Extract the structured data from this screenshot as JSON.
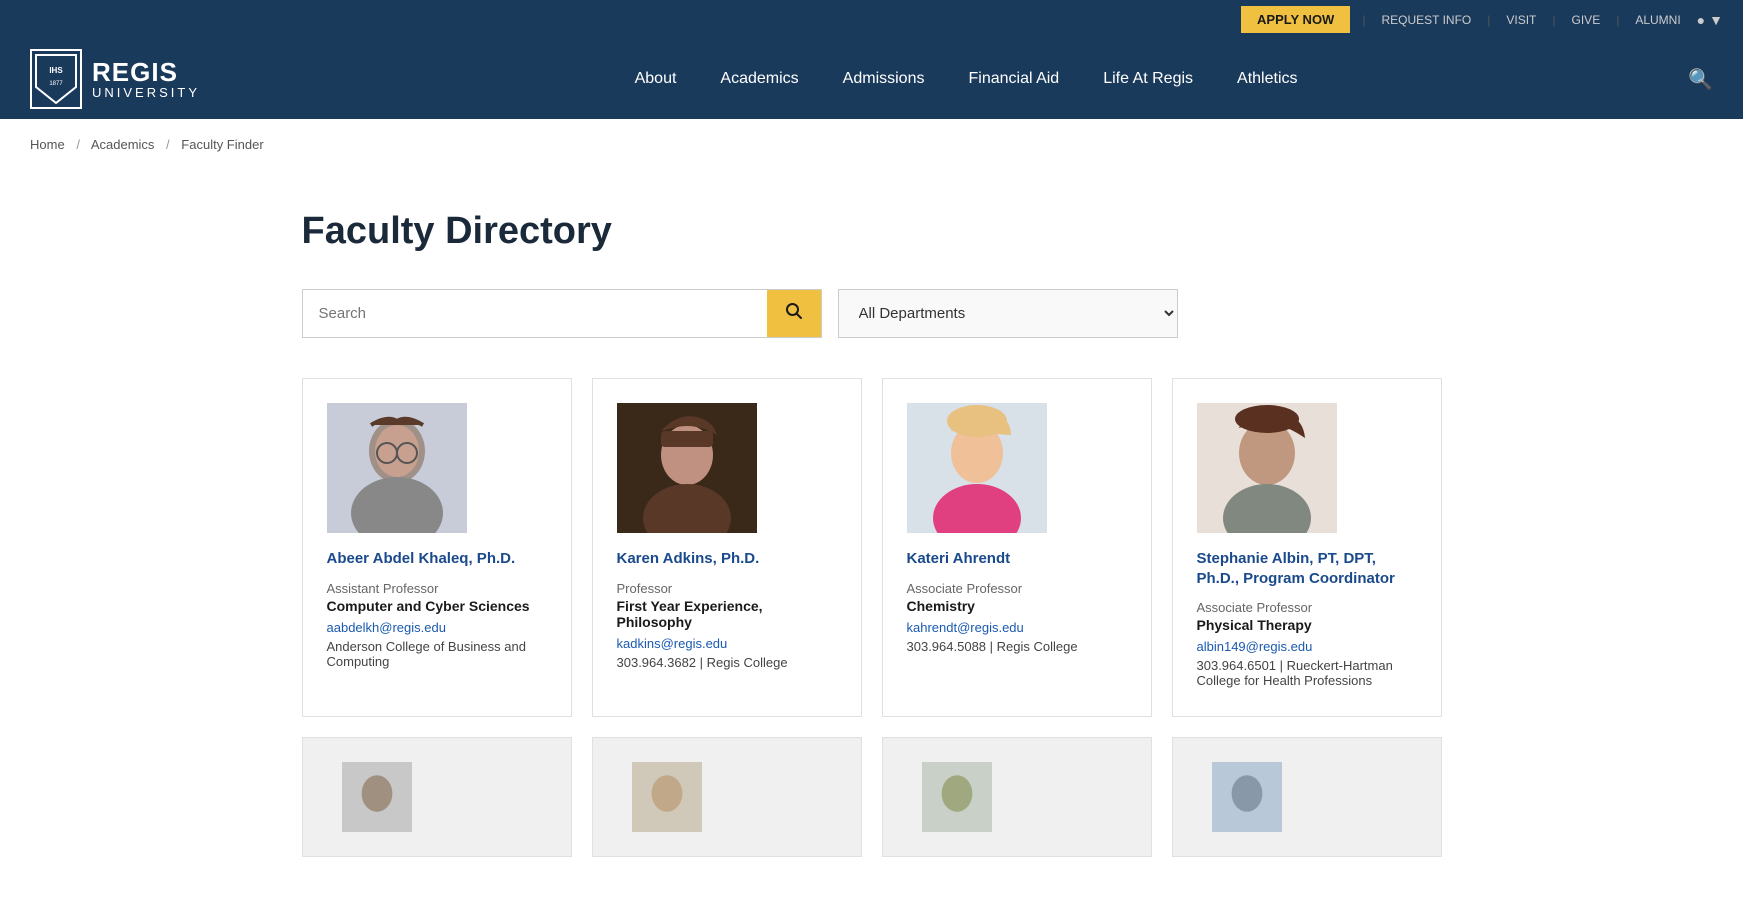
{
  "utility": {
    "apply_now": "APPLY NOW",
    "request_info": "REQUEST INFO",
    "visit": "VISIT",
    "give": "GIVE",
    "alumni": "ALUMNI"
  },
  "nav": {
    "logo_regis": "REGIS",
    "logo_university": "UNIVERSITY",
    "logo_ihs": "IHS",
    "items": [
      {
        "label": "About",
        "id": "about"
      },
      {
        "label": "Academics",
        "id": "academics"
      },
      {
        "label": "Admissions",
        "id": "admissions"
      },
      {
        "label": "Financial Aid",
        "id": "financial-aid"
      },
      {
        "label": "Life At Regis",
        "id": "life-at-regis"
      },
      {
        "label": "Athletics",
        "id": "athletics"
      }
    ]
  },
  "breadcrumb": {
    "items": [
      {
        "label": "Home",
        "href": "#"
      },
      {
        "label": "Academics",
        "href": "#"
      },
      {
        "label": "Faculty Finder",
        "href": "#"
      }
    ]
  },
  "main": {
    "page_title": "Faculty Directory",
    "search_placeholder": "Search",
    "department_label": "All Departments",
    "search_button_label": "🔍"
  },
  "faculty": [
    {
      "name": "Abeer Abdel Khaleq, Ph.D.",
      "title": "Assistant Professor",
      "department": "Computer and Cyber Sciences",
      "email": "aabdelkh@regis.edu",
      "phone": "",
      "college": "Anderson College of Business and Computing",
      "photo_bg": "#b0b8c8"
    },
    {
      "name": "Karen Adkins, Ph.D.",
      "title": "Professor",
      "department": "First Year Experience, Philosophy",
      "email": "kadkins@regis.edu",
      "phone": "303.964.3682",
      "college": "Regis College",
      "photo_bg": "#5a4030"
    },
    {
      "name": "Kateri Ahrendt",
      "title": "Associate Professor",
      "department": "Chemistry",
      "email": "kahrendt@regis.edu",
      "phone": "303.964.5088",
      "college": "Regis College",
      "photo_bg": "#e080a0"
    },
    {
      "name": "Stephanie Albin, PT, DPT, Ph.D., Program Coordinator",
      "title": "Associate Professor",
      "department": "Physical Therapy",
      "email": "albin149@regis.edu",
      "phone": "303.964.6501",
      "college": "Rueckert-Hartman College for Health Professions",
      "photo_bg": "#a08878"
    }
  ],
  "colors": {
    "navy": "#1a3a5c",
    "gold": "#f0c040",
    "link_blue": "#1a4a8c"
  }
}
